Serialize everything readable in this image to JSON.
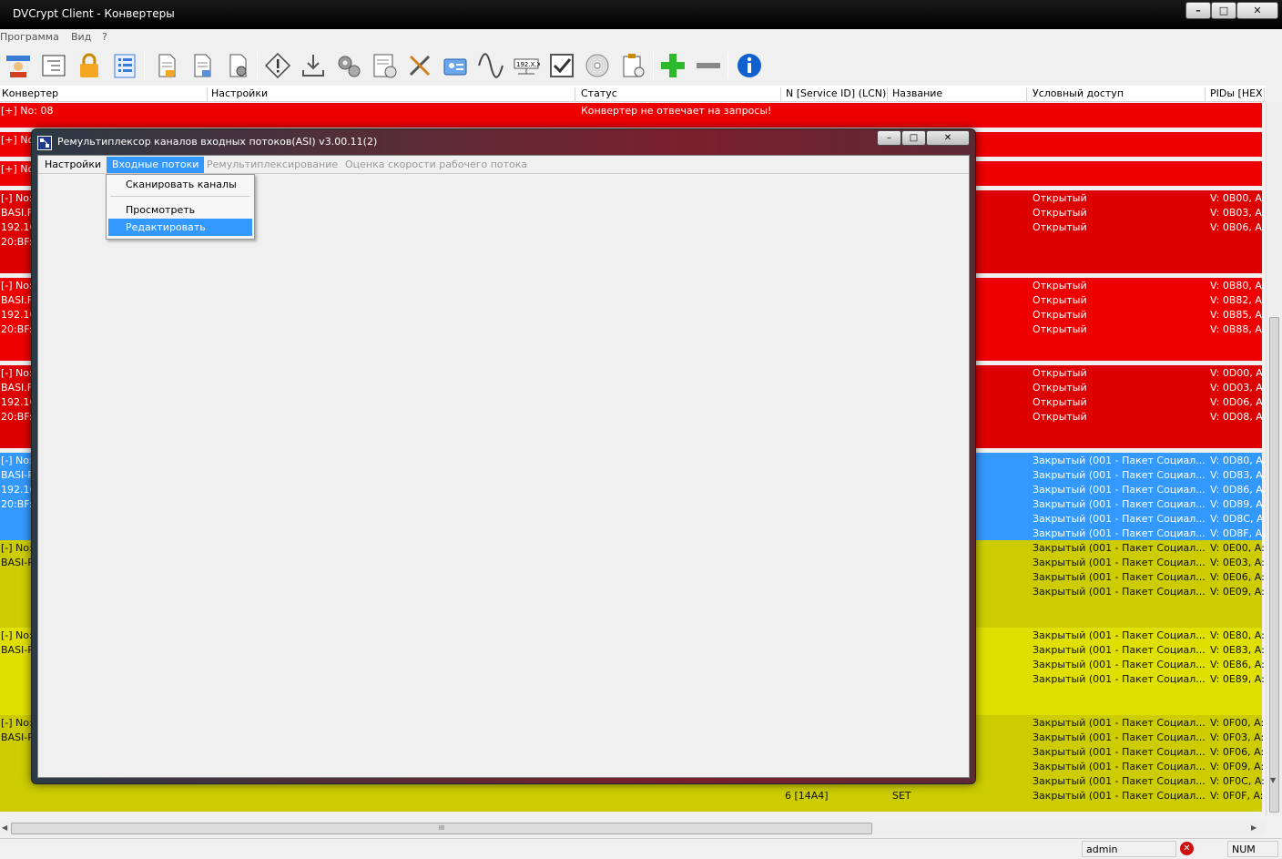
{
  "window": {
    "title": "DVCrypt Client - Конвертеры"
  },
  "menubar": {
    "items": [
      "Программа",
      "Вид",
      "?"
    ]
  },
  "toolbar": {
    "icons": [
      "user-icon",
      "tree-icon",
      "lock-icon",
      "list-icon",
      "document-icon",
      "document-export-icon",
      "document-settings-icon",
      "warning-icon",
      "download-icon",
      "gears-icon",
      "report-icon",
      "tools-icon",
      "id-card-icon",
      "sine-wave-icon",
      "ip-icon",
      "checkbox-icon",
      "disc-icon",
      "clipboard-icon",
      "plus-icon",
      "minus-icon",
      "info-icon"
    ]
  },
  "table": {
    "columns": [
      "Конвертер",
      "Настройки",
      "Статус",
      "N [Service ID] (LCN)",
      "Название",
      "Условный доступ",
      "PIDы [HEX"
    ],
    "colors": {
      "red": "#ee0000",
      "darkred": "#dd0000",
      "blue": "#3399ff",
      "yellow": "#cccc00",
      "lightyellow": "#e0e000"
    },
    "row1": {
      "left": "[+] No: 08",
      "status": "Конвертер не отвечает на запросы!"
    },
    "row2": {
      "left": "[+] No"
    },
    "row3": {
      "left": "[+] No"
    },
    "g4": {
      "left": [
        "[-] No:",
        "BASI.F",
        "192.16",
        "20:BF:"
      ],
      "access": [
        "Открытый",
        "Открытый",
        "Открытый"
      ],
      "pids": [
        "V: 0B00, A:",
        "V: 0B03, A:",
        "V: 0B06, A:"
      ]
    },
    "g5": {
      "left": [
        "[-] No:",
        "BASI.F",
        "192.16",
        "20:BF:"
      ],
      "access": [
        "Открытый",
        "Открытый",
        "Открытый",
        "Открытый"
      ],
      "pids": [
        "V: 0B80, A:",
        "V: 0B82, A:",
        "V: 0B85, A:",
        "V: 0B88, A:"
      ]
    },
    "g6": {
      "left": [
        "[-] No:",
        "BASI.F",
        "192.16",
        "20:BF:"
      ],
      "access": [
        "Открытый",
        "Открытый",
        "Открытый",
        "Открытый"
      ],
      "pids": [
        "V: 0D00, A:",
        "V: 0D03, A:",
        "V: 0D06, A:",
        "V: 0D08, A:"
      ]
    },
    "g7": {
      "left": [
        "[-] No:",
        "BASI-R",
        "192.16",
        "20:BF:"
      ],
      "access": [
        "Закрытый (001 - Пакет Социал...",
        "Закрытый (001 - Пакет Социал...",
        "Закрытый (001 - Пакет Социал...",
        "Закрытый (001 - Пакет Социал...",
        "Закрытый (001 - Пакет Социал...",
        "Закрытый (001 - Пакет Социал..."
      ],
      "pids": [
        "V: 0D80, A:",
        "V: 0D83, A:",
        "V: 0D86, A:",
        "V: 0D89, A:",
        "V: 0D8C, A",
        "V: 0D8F, A:"
      ]
    },
    "g8": {
      "left": [
        "[-] No:",
        "BASI-R"
      ],
      "access": [
        "Закрытый (001 - Пакет Социал...",
        "Закрытый (001 - Пакет Социал...",
        "Закрытый (001 - Пакет Социал...",
        "Закрытый (001 - Пакет Социал..."
      ],
      "pids": [
        "V: 0E00, A:",
        "V: 0E03, A:",
        "V: 0E06, A:",
        "V: 0E09, A:"
      ]
    },
    "g9": {
      "left": [
        "[-] No:",
        "BASI-R"
      ],
      "access": [
        "Закрытый (001 - Пакет Социал...",
        "Закрытый (001 - Пакет Социал...",
        "Закрытый (001 - Пакет Социал...",
        "Закрытый (001 - Пакет Социал..."
      ],
      "pids": [
        "V: 0E80, A:",
        "V: 0E83, A:",
        "V: 0E86, A:",
        "V: 0E89, A:"
      ]
    },
    "g10": {
      "left": [
        "[-] No:",
        "BASI-R"
      ],
      "access": [
        "Закрытый (001 - Пакет Социал...",
        "Закрытый (001 - Пакет Социал...",
        "Закрытый (001 - Пакет Социал...",
        "Закрытый (001 - Пакет Социал...",
        "Закрытый (001 - Пакет Социал...",
        "Закрытый (001 - Пакет Социал..."
      ],
      "pids": [
        "V: 0F00, A:",
        "V: 0F03, A:",
        "V: 0F06, A:",
        "V: 0F09, A:",
        "V: 0F0C, A:",
        "V: 0F0F, A:"
      ],
      "lcn": "6 [14A4]",
      "name": "SET"
    }
  },
  "dialog": {
    "title": "Ремультиплексор каналов входных потоков(ASI)  v3.00.11(2)",
    "tabs": [
      "Настройки",
      "Входные потоки",
      "Ремультиплексирование",
      "Оценка скорости рабочего потока"
    ],
    "menu": [
      "Сканировать каналы",
      "Просмотреть",
      "Редактировать"
    ]
  },
  "statusbar": {
    "user": "admin",
    "num": "NUM"
  },
  "hscroll": {
    "grip": "III"
  }
}
